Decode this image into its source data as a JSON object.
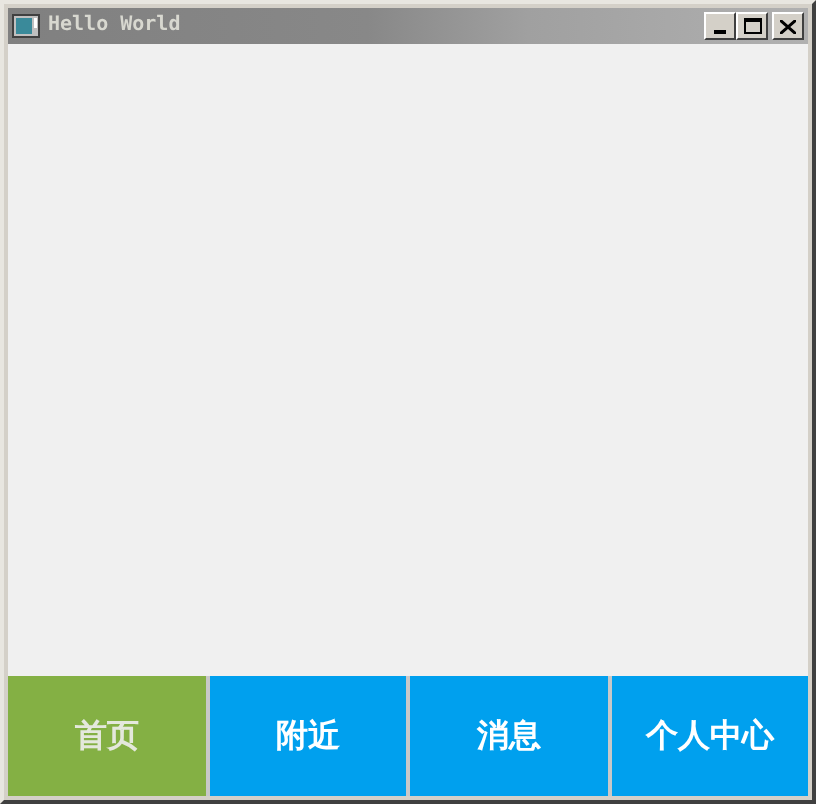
{
  "window": {
    "title": "Hello World"
  },
  "tabs": [
    {
      "label": "首页",
      "selected": true
    },
    {
      "label": "附近",
      "selected": false
    },
    {
      "label": "消息",
      "selected": false
    },
    {
      "label": "个人中心",
      "selected": false
    }
  ]
}
